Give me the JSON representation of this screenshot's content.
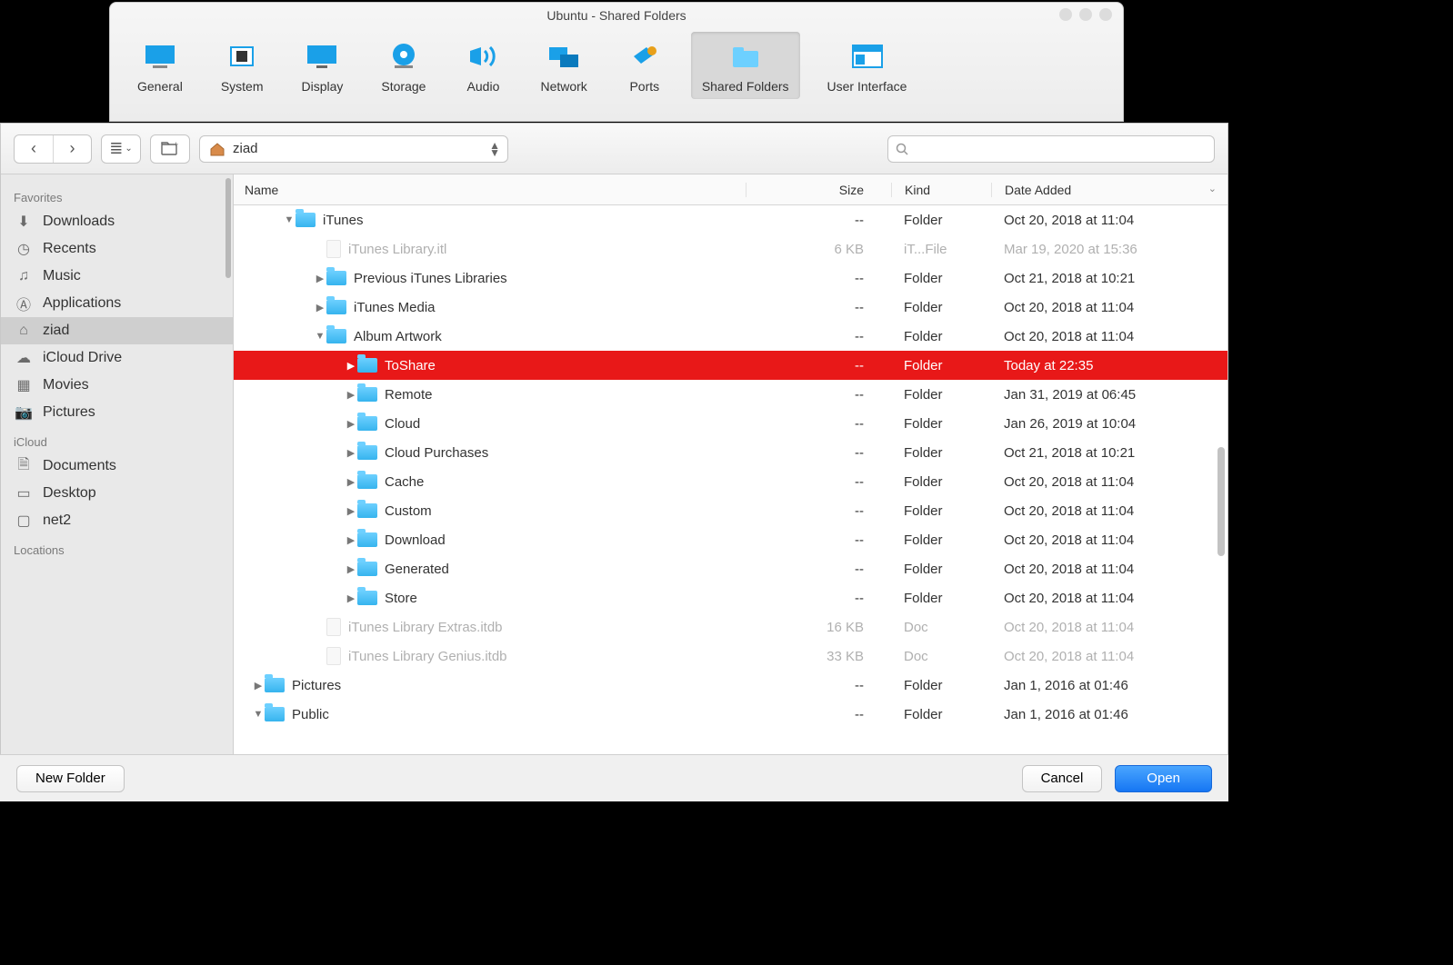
{
  "vb_window": {
    "title": "Ubuntu - Shared Folders",
    "tabs": [
      {
        "label": "General"
      },
      {
        "label": "System"
      },
      {
        "label": "Display"
      },
      {
        "label": "Storage"
      },
      {
        "label": "Audio"
      },
      {
        "label": "Network"
      },
      {
        "label": "Ports"
      },
      {
        "label": "Shared Folders"
      },
      {
        "label": "User Interface"
      }
    ],
    "active_tab": 7
  },
  "chooser": {
    "path_label": "ziad",
    "search_placeholder": "",
    "columns": {
      "name": "Name",
      "size": "Size",
      "kind": "Kind",
      "date": "Date Added"
    },
    "buttons": {
      "new_folder": "New Folder",
      "cancel": "Cancel",
      "open": "Open"
    }
  },
  "sidebar": {
    "sections": [
      {
        "title": "Favorites",
        "items": [
          {
            "label": "Downloads",
            "icon": "download"
          },
          {
            "label": "Recents",
            "icon": "clock"
          },
          {
            "label": "Music",
            "icon": "music"
          },
          {
            "label": "Applications",
            "icon": "apps"
          },
          {
            "label": "ziad",
            "icon": "home",
            "selected": true
          },
          {
            "label": "iCloud Drive",
            "icon": "cloud"
          },
          {
            "label": "Movies",
            "icon": "film"
          },
          {
            "label": "Pictures",
            "icon": "camera"
          }
        ]
      },
      {
        "title": "iCloud",
        "items": [
          {
            "label": "Documents",
            "icon": "doc"
          },
          {
            "label": "Desktop",
            "icon": "desktop"
          },
          {
            "label": "net2",
            "icon": "folder"
          }
        ]
      },
      {
        "title": "Locations",
        "items": []
      }
    ]
  },
  "files": [
    {
      "indent": 1,
      "arrow": "down",
      "type": "folder",
      "name": "iTunes",
      "size": "--",
      "kind": "Folder",
      "date": "Oct 20, 2018 at 11:04"
    },
    {
      "indent": 2,
      "arrow": "",
      "type": "file",
      "name": "iTunes Library.itl",
      "size": "6 KB",
      "kind": "iT...File",
      "date": "Mar 19, 2020 at 15:36",
      "dim": true
    },
    {
      "indent": 2,
      "arrow": "right",
      "type": "folder",
      "name": "Previous iTunes Libraries",
      "size": "--",
      "kind": "Folder",
      "date": "Oct 21, 2018 at 10:21"
    },
    {
      "indent": 2,
      "arrow": "right",
      "type": "folder",
      "name": "iTunes Media",
      "size": "--",
      "kind": "Folder",
      "date": "Oct 20, 2018 at 11:04"
    },
    {
      "indent": 2,
      "arrow": "down",
      "type": "folder",
      "name": "Album Artwork",
      "size": "--",
      "kind": "Folder",
      "date": "Oct 20, 2018 at 11:04"
    },
    {
      "indent": 3,
      "arrow": "right",
      "type": "folder",
      "name": "ToShare",
      "size": "--",
      "kind": "Folder",
      "date": "Today at 22:35",
      "selected": true
    },
    {
      "indent": 3,
      "arrow": "right",
      "type": "folder",
      "name": "Remote",
      "size": "--",
      "kind": "Folder",
      "date": "Jan 31, 2019 at 06:45"
    },
    {
      "indent": 3,
      "arrow": "right",
      "type": "folder",
      "name": "Cloud",
      "size": "--",
      "kind": "Folder",
      "date": "Jan 26, 2019 at 10:04"
    },
    {
      "indent": 3,
      "arrow": "right",
      "type": "folder",
      "name": "Cloud Purchases",
      "size": "--",
      "kind": "Folder",
      "date": "Oct 21, 2018 at 10:21"
    },
    {
      "indent": 3,
      "arrow": "right",
      "type": "folder",
      "name": "Cache",
      "size": "--",
      "kind": "Folder",
      "date": "Oct 20, 2018 at 11:04"
    },
    {
      "indent": 3,
      "arrow": "right",
      "type": "folder",
      "name": "Custom",
      "size": "--",
      "kind": "Folder",
      "date": "Oct 20, 2018 at 11:04"
    },
    {
      "indent": 3,
      "arrow": "right",
      "type": "folder",
      "name": "Download",
      "size": "--",
      "kind": "Folder",
      "date": "Oct 20, 2018 at 11:04"
    },
    {
      "indent": 3,
      "arrow": "right",
      "type": "folder",
      "name": "Generated",
      "size": "--",
      "kind": "Folder",
      "date": "Oct 20, 2018 at 11:04"
    },
    {
      "indent": 3,
      "arrow": "right",
      "type": "folder",
      "name": "Store",
      "size": "--",
      "kind": "Folder",
      "date": "Oct 20, 2018 at 11:04"
    },
    {
      "indent": 2,
      "arrow": "",
      "type": "file",
      "name": "iTunes Library Extras.itdb",
      "size": "16 KB",
      "kind": "Doc",
      "date": "Oct 20, 2018 at 11:04",
      "dim": true
    },
    {
      "indent": 2,
      "arrow": "",
      "type": "file",
      "name": "iTunes Library Genius.itdb",
      "size": "33 KB",
      "kind": "Doc",
      "date": "Oct 20, 2018 at 11:04",
      "dim": true
    },
    {
      "indent": 0,
      "arrow": "right",
      "type": "folder",
      "name": "Pictures",
      "size": "--",
      "kind": "Folder",
      "date": "Jan 1, 2016 at 01:46"
    },
    {
      "indent": 0,
      "arrow": "down",
      "type": "folder",
      "name": "Public",
      "size": "--",
      "kind": "Folder",
      "date": "Jan 1, 2016 at 01:46"
    }
  ]
}
